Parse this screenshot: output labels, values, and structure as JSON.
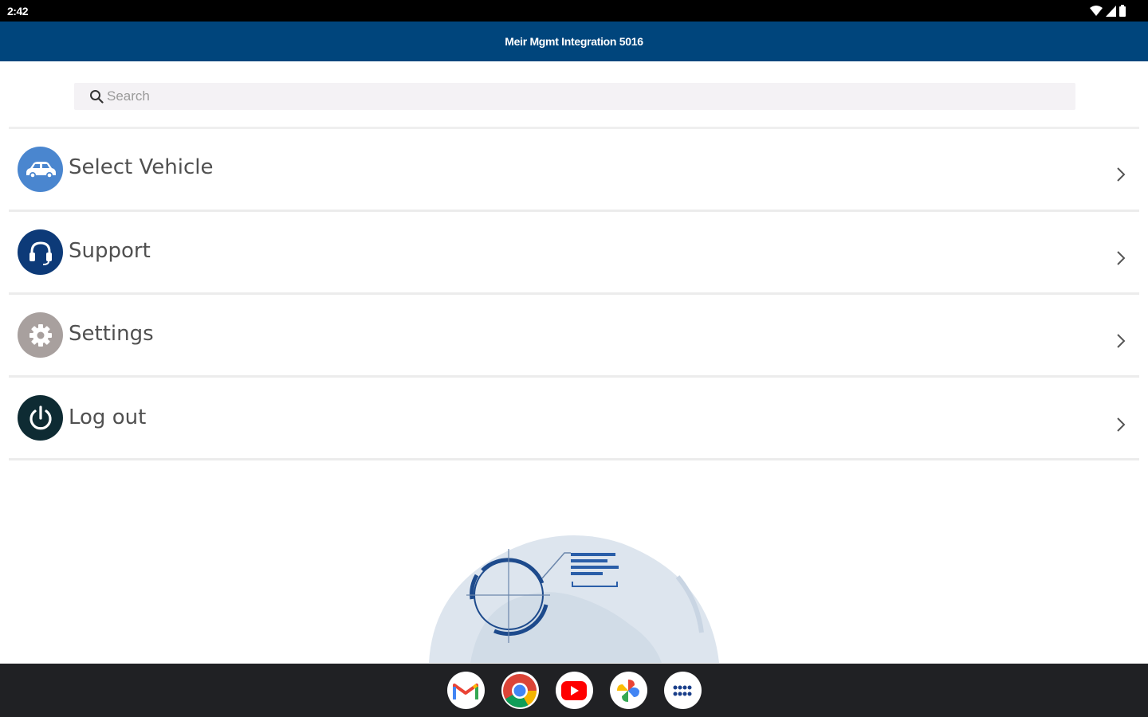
{
  "status_bar": {
    "time": "2:42"
  },
  "header": {
    "title": "Meir Mgmt Integration 5016"
  },
  "search": {
    "placeholder": "Search"
  },
  "menu": {
    "items": [
      {
        "label": "Select Vehicle",
        "icon": "car-icon",
        "icon_color": "#4a86cf"
      },
      {
        "label": "Support",
        "icon": "headset-icon",
        "icon_color": "#0d3a78"
      },
      {
        "label": "Settings",
        "icon": "gear-icon",
        "icon_color": "#a8a09e"
      },
      {
        "label": "Log out",
        "icon": "power-icon",
        "icon_color": "#0e2b33"
      }
    ]
  },
  "dock": {
    "apps": [
      "gmail-icon",
      "chrome-icon",
      "youtube-icon",
      "photos-icon",
      "app-drawer-icon"
    ]
  },
  "colors": {
    "header_bg": "#00457c",
    "nav_bg": "#202124"
  }
}
